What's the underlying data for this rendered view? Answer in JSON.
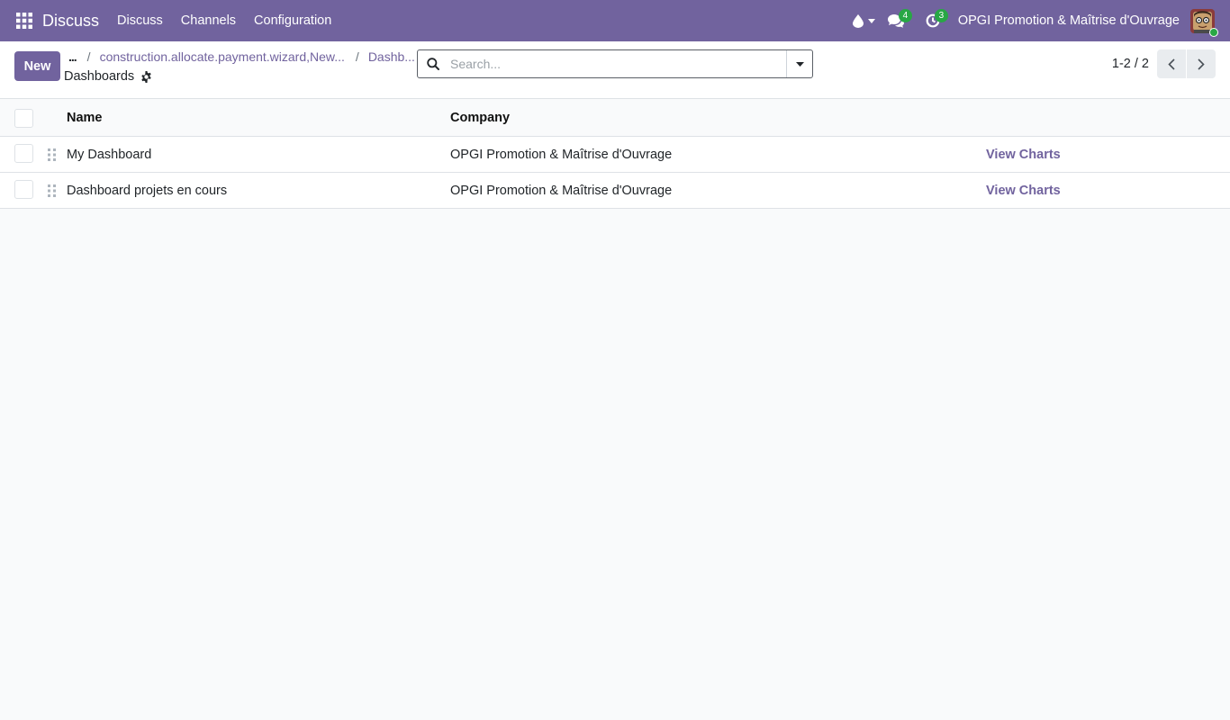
{
  "theme": {
    "brand_color": "#71639e",
    "badge_color": "#28a745"
  },
  "navbar": {
    "apps_icon": "grid-icon",
    "app_name": "Discuss",
    "menu": [
      "Discuss",
      "Channels",
      "Configuration"
    ],
    "systray": {
      "activity_icon": "drop-icon",
      "messages_icon": "chat-bubbles-icon",
      "messages_count": "4",
      "activities_icon": "clock-icon",
      "activities_count": "3"
    },
    "company": "OPGI Promotion & Maîtrise d'Ouvrage",
    "avatar_icon": "user-avatar-icon"
  },
  "control_panel": {
    "new_button": "New",
    "breadcrumb": {
      "ellipsis": "...",
      "separator": "/",
      "items": [
        "construction.allocate.payment.wizard,New...",
        "Dashb..."
      ],
      "current": "Dashboards"
    },
    "search": {
      "placeholder": "Search..."
    },
    "pager": {
      "value": "1-2 / 2"
    }
  },
  "list": {
    "columns": [
      "Name",
      "Company"
    ],
    "rows": [
      {
        "name": "My Dashboard",
        "company": "OPGI Promotion & Maîtrise d'Ouvrage",
        "action": "View Charts"
      },
      {
        "name": "Dashboard projets en cours",
        "company": "OPGI Promotion & Maîtrise d'Ouvrage",
        "action": "View Charts"
      }
    ]
  }
}
